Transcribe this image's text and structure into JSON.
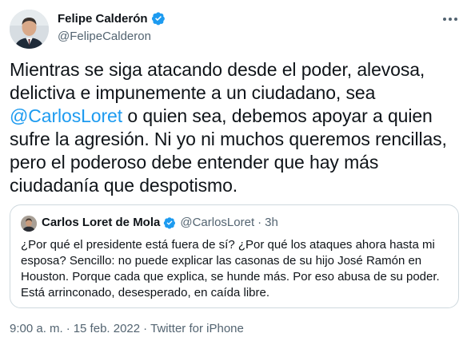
{
  "author": {
    "name": "Felipe Calderón",
    "handle": "@FelipeCalderon"
  },
  "tweet": {
    "text_before": "Mientras se siga atacando desde el poder, alevosa, delictiva e impunemente a un ciudadano, sea ",
    "mention": "@CarlosLoret",
    "text_after": " o quien sea, debemos apoyar a quien sufre la agresión. Ni yo ni muchos queremos rencillas, pero el poderoso debe entender que hay más ciudadanía que despotismo."
  },
  "quote": {
    "name": "Carlos Loret de Mola",
    "handle": "@CarlosLoret",
    "separator": "·",
    "time": "3h",
    "text": "¿Por qué el presidente está fuera de sí? ¿Por qué los ataques ahora hasta mi esposa? Sencillo: no puede explicar las casonas de su hijo José Ramón en Houston. Porque cada que explica, se hunde más. Por eso abusa de su poder. Está arrinconado, desesperado, en caída libre."
  },
  "meta": {
    "time": "9:00 a. m.",
    "separator1": "·",
    "date": "15 feb. 2022",
    "separator2": "·",
    "source": "Twitter for iPhone"
  },
  "icons": {
    "verified": "verified-badge-icon",
    "more": "more-options-icon"
  },
  "colors": {
    "accent": "#1d9bf0",
    "text": "#0f1419",
    "secondary": "#536471",
    "border": "#cfd9de"
  }
}
